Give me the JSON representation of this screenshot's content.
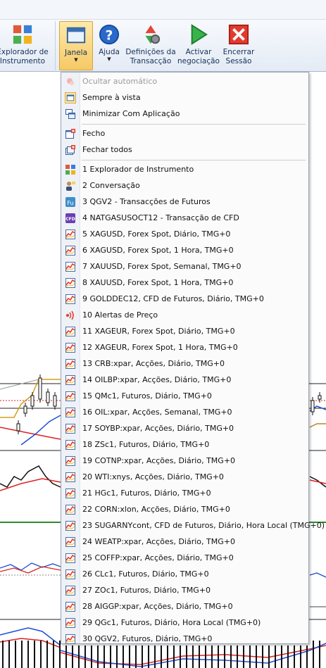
{
  "ribbon": {
    "buttons": [
      {
        "id": "explorer",
        "label": "Explorador de\nInstrumento",
        "icon": "grid-apps-icon"
      },
      {
        "id": "janela",
        "label": "Janela",
        "icon": "window-icon",
        "dropdown": true,
        "active": true
      },
      {
        "id": "ajuda",
        "label": "Ajuda",
        "icon": "help-icon",
        "dropdown": true
      },
      {
        "id": "defs",
        "label": "Definições da\nTransacção",
        "icon": "settings-gear-icon"
      },
      {
        "id": "activar",
        "label": "Activar\nnegociação",
        "icon": "play-icon"
      },
      {
        "id": "encerrar",
        "label": "Encerrar\nSessão",
        "icon": "close-icon"
      }
    ]
  },
  "menu": {
    "top": [
      {
        "label": "Ocultar automático",
        "icon": "pin-icon",
        "disabled": true
      },
      {
        "label": "Sempre à vista",
        "icon": "window-frame-icon",
        "checked": true
      },
      {
        "label": "Minimizar Com Aplicação",
        "icon": "minimize-window-icon"
      }
    ],
    "close": [
      {
        "label": "Fecho",
        "icon": "close-window-icon"
      },
      {
        "label": "Fechar todos",
        "icon": "close-all-windows-icon"
      }
    ],
    "windows": [
      {
        "label": "1 Explorador de Instrumento",
        "icon": "grid-apps-icon"
      },
      {
        "label": "2 Conversação",
        "icon": "chat-user-icon"
      },
      {
        "label": "3 QGV2 - Transacções de Futuros",
        "icon": "futures-icon"
      },
      {
        "label": "4 NATGASUSOCT12 - Transacção de CFD",
        "icon": "cfd-icon"
      },
      {
        "label": "5 XAGUSD, Forex Spot, Diário, TMG+0",
        "icon": "chart-icon"
      },
      {
        "label": "6 XAGUSD, Forex Spot, 1 Hora, TMG+0",
        "icon": "chart-icon"
      },
      {
        "label": "7 XAUUSD, Forex Spot, Semanal, TMG+0",
        "icon": "chart-icon"
      },
      {
        "label": "8 XAUUSD, Forex Spot, 1 Hora, TMG+0",
        "icon": "chart-icon"
      },
      {
        "label": "9 GOLDDEC12, CFD de Futuros, Diário, TMG+0",
        "icon": "chart-icon"
      },
      {
        "label": "10 Alertas de Preço",
        "icon": "price-alert-icon"
      },
      {
        "label": "11 XAGEUR, Forex Spot, Diário, TMG+0",
        "icon": "chart-icon"
      },
      {
        "label": "12 XAGEUR, Forex Spot, 1 Hora, TMG+0",
        "icon": "chart-icon"
      },
      {
        "label": "13 CRB:xpar, Acções, Diário, TMG+0",
        "icon": "chart-icon"
      },
      {
        "label": "14 OILBP:xpar, Acções, Diário, TMG+0",
        "icon": "chart-icon"
      },
      {
        "label": "15 QMc1, Futuros, Diário, TMG+0",
        "icon": "chart-icon"
      },
      {
        "label": "16 OIL:xpar, Acções, Semanal, TMG+0",
        "icon": "chart-icon"
      },
      {
        "label": "17 SOYBP:xpar, Acções, Diário, TMG+0",
        "icon": "chart-icon"
      },
      {
        "label": "18 ZSc1, Futuros, Diário, TMG+0",
        "icon": "chart-icon"
      },
      {
        "label": "19 COTNP:xpar, Acções, Diário, TMG+0",
        "icon": "chart-icon"
      },
      {
        "label": "20 WTI:xnys, Acções, Diário, TMG+0",
        "icon": "chart-icon"
      },
      {
        "label": "21 HGc1, Futuros, Diário, TMG+0",
        "icon": "chart-icon"
      },
      {
        "label": "22 CORN:xlon, Acções, Diário, TMG+0",
        "icon": "chart-icon"
      },
      {
        "label": "23 SUGARNYcont, CFD de Futuros, Diário, Hora Local (TMG+0)",
        "icon": "chart-icon"
      },
      {
        "label": "24 WEATP:xpar, Acções, Diário, TMG+0",
        "icon": "chart-icon"
      },
      {
        "label": "25 COFFP:xpar, Acções, Diário, TMG+0",
        "icon": "chart-icon"
      },
      {
        "label": "26 CLc1, Futuros, Diário, TMG+0",
        "icon": "chart-icon"
      },
      {
        "label": "27 ZOc1, Futuros, Diário, TMG+0",
        "icon": "chart-icon"
      },
      {
        "label": "28 AIGGP:xpar, Acções, Diário, TMG+0",
        "icon": "chart-icon"
      },
      {
        "label": "29 QGc1, Futuros, Diário, Hora Local (TMG+0)",
        "icon": "chart-icon"
      },
      {
        "label": "30 QGV2, Futuros, Diário, TMG+0",
        "icon": "chart-icon"
      }
    ]
  }
}
